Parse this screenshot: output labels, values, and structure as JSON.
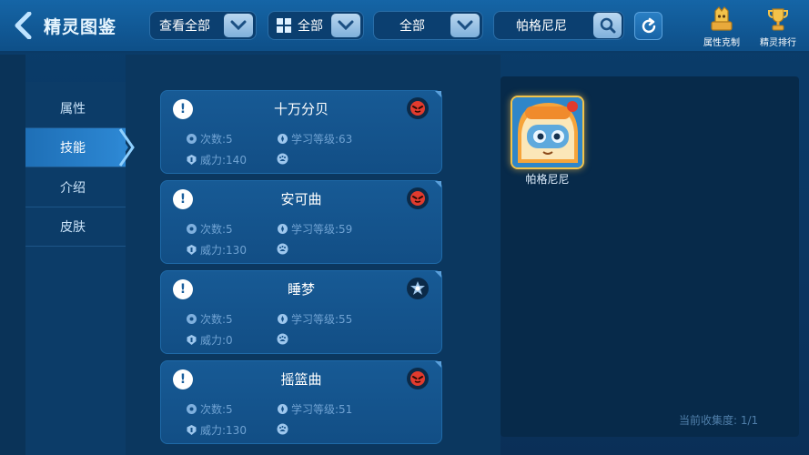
{
  "header": {
    "title": "精灵图鉴",
    "filter_view": "查看全部",
    "filter_type": "全部",
    "filter_all": "全部",
    "search_value": "帕格尼尼",
    "type_chart_label": "属性克制",
    "ranking_label": "精灵排行"
  },
  "nav": {
    "items": [
      {
        "label": "属性"
      },
      {
        "label": "技能"
      },
      {
        "label": "介绍"
      },
      {
        "label": "皮肤"
      }
    ],
    "active_index": 1
  },
  "skills": [
    {
      "name": "十万分贝",
      "uses": "次数:5",
      "level": "学习等级:63",
      "power": "威力:140",
      "type_icon": "fire-face-icon"
    },
    {
      "name": "安可曲",
      "uses": "次数:5",
      "level": "学习等级:59",
      "power": "威力:130",
      "type_icon": "fire-face-icon"
    },
    {
      "name": "睡梦",
      "uses": "次数:5",
      "level": "学习等级:55",
      "power": "威力:0",
      "type_icon": "star-icon"
    },
    {
      "name": "摇篮曲",
      "uses": "次数:5",
      "level": "学习等级:51",
      "power": "威力:130",
      "type_icon": "fire-face-icon"
    }
  ],
  "pet": {
    "name": "帕格尼尼"
  },
  "collection": {
    "text": "当前收集度: 1/1"
  },
  "colors": {
    "accent": "#2d88d4",
    "selected_border": "#f2c34a",
    "fire": "#e23b2e"
  }
}
